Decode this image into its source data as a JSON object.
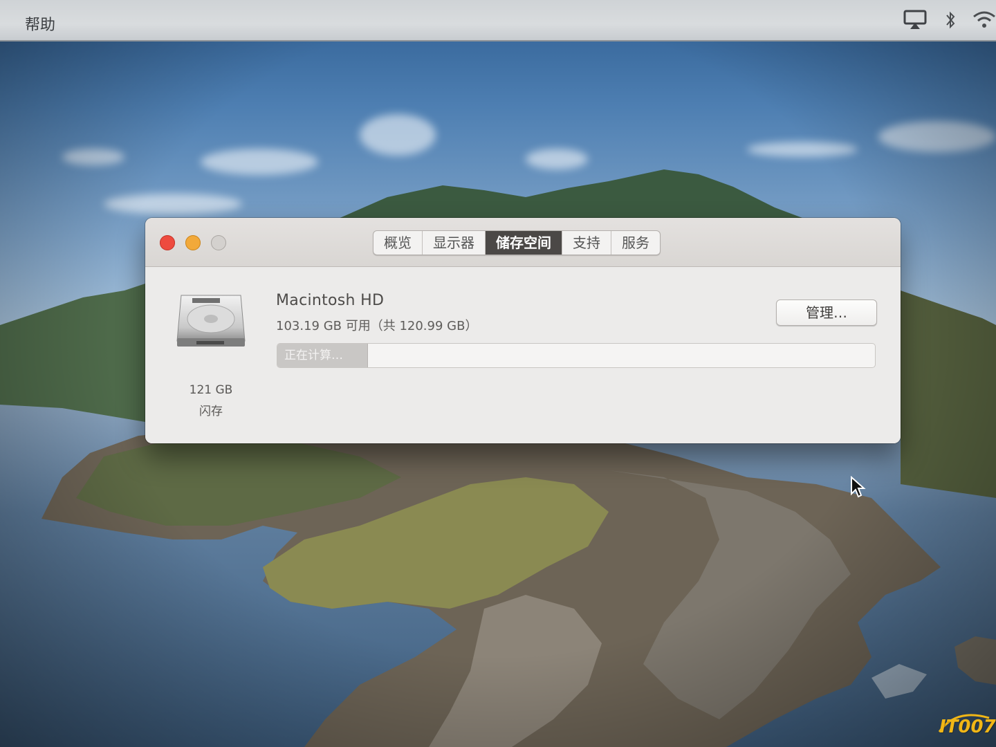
{
  "menubar": {
    "help_label": "帮助",
    "status_icons": [
      "airplay-icon",
      "bluetooth-icon",
      "wifi-icon"
    ]
  },
  "window": {
    "traffic_lights": [
      "close",
      "minimize",
      "zoom"
    ],
    "tabs": [
      {
        "label": "概览",
        "active": false
      },
      {
        "label": "显示器",
        "active": false
      },
      {
        "label": "储存空间",
        "active": true
      },
      {
        "label": "支持",
        "active": false
      },
      {
        "label": "服务",
        "active": false
      }
    ],
    "disk": {
      "icon": "hard-drive-icon",
      "size": "121 GB",
      "type": "闪存"
    },
    "volume": {
      "name": "Macintosh HD",
      "available": "103.19 GB 可用（共 120.99 GB）"
    },
    "manage_button": "管理…",
    "usage_bar": {
      "status_text": "正在计算…",
      "fill_fraction": 0.15
    }
  },
  "watermark": "IT007",
  "colors": {
    "close": "#ee4b3f",
    "minimize": "#f2a93a",
    "zoom": "#d4d1ce",
    "active_tab": "#4b4846",
    "watermark": "#f1b616"
  }
}
